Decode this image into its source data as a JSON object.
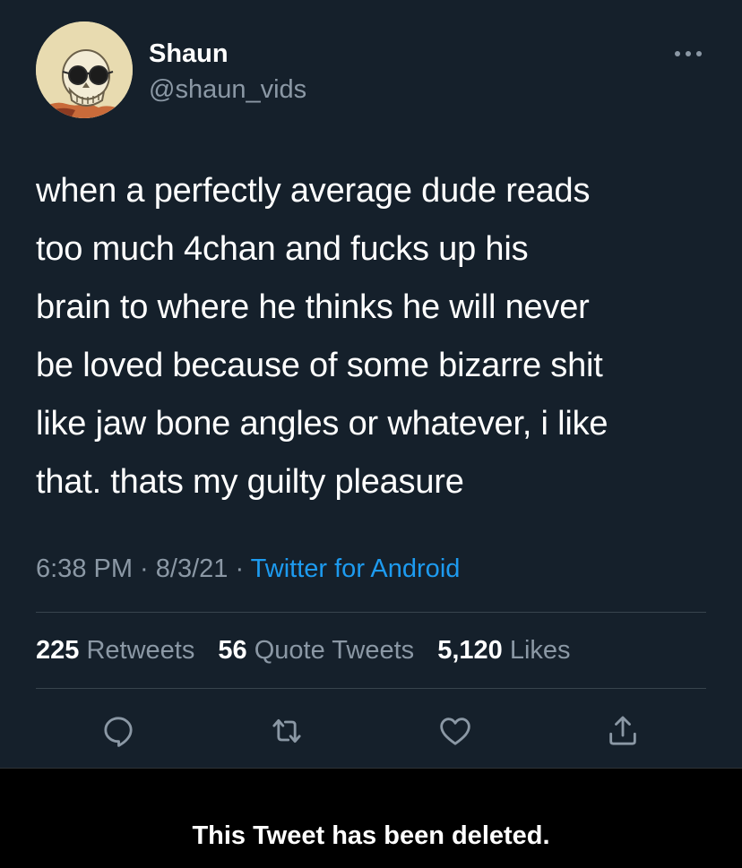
{
  "tweet": {
    "author": {
      "display_name": "Shaun",
      "handle": "@shaun_vids",
      "avatar_icon": "skull-with-sunglasses-avatar"
    },
    "text_lines": [
      "when a perfectly average dude reads",
      "too much 4chan and fucks up his",
      "brain to where he thinks he will never",
      "be loved because of some bizarre shit",
      "like jaw bone angles or whatever, i like",
      "that. thats my guilty pleasure"
    ],
    "time": "6:38 PM",
    "separator": " · ",
    "date": "8/3/21",
    "source": "Twitter for Android",
    "stats": {
      "retweets_count": "225",
      "retweets_label": "Retweets",
      "quotes_count": "56",
      "quotes_label": "Quote Tweets",
      "likes_count": "5,120",
      "likes_label": "Likes"
    },
    "actions": [
      "reply-icon",
      "retweet-icon",
      "like-icon",
      "share-icon"
    ]
  },
  "notice": {
    "text": "This Tweet has been deleted."
  },
  "colors": {
    "background": "#15202b",
    "secondary_text": "#8b98a5",
    "link": "#1d9bf0",
    "divider": "#38444d",
    "notice_background": "#000000"
  }
}
